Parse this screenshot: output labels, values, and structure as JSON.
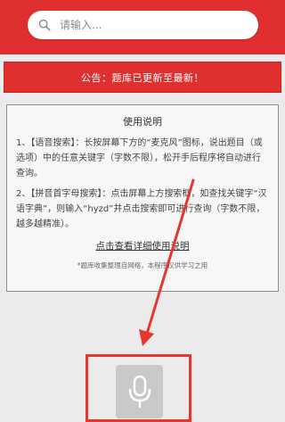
{
  "search": {
    "placeholder": "请输入...",
    "icon": "search-icon"
  },
  "notice": {
    "text": "公告：题库已更新至最新！"
  },
  "instructions": {
    "title": "使用说明",
    "paragraph_1": "1、【语音搜索】：长按屏幕下方的“麦克风”图标，说出题目（或选项）中的任意关键字（字数不限），松开手后程序将自动进行查询。",
    "paragraph_2": "2、【拼音首字母搜索】：点击屏幕上方搜索框，如查找关键字“汉语字典”，则输入“hyzd”并点击搜索即可进行查询（字数不限，越多越精准）。",
    "detail_link": "点击查看详细使用说明",
    "footnote": "*题库收集整理自网络，本程序仅供学习之用"
  },
  "voice": {
    "icon": "microphone-icon"
  },
  "colors": {
    "brand_red": "#e02f2f",
    "annotation_red": "#e8352e",
    "background": "#ebebeb"
  }
}
